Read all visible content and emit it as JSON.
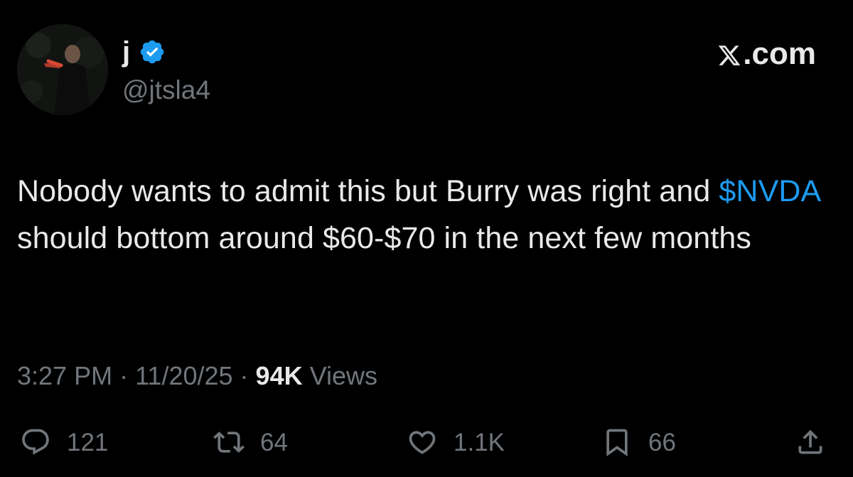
{
  "header": {
    "display_name": "j",
    "handle": "@jtsla4",
    "brand": ".com",
    "verified": true
  },
  "tweet": {
    "text_before": "Nobody wants to admit this but Burry was right and ",
    "cashtag": "$NVDA",
    "text_after": " should bottom around $60-$70 in the next few months"
  },
  "meta": {
    "time": "3:27 PM",
    "sep1": " · ",
    "date": "11/20/25",
    "sep2": " · ",
    "views_count": "94K",
    "views_label": " Views"
  },
  "actions": {
    "replies": "121",
    "reposts": "64",
    "likes": "1.1K",
    "bookmarks": "66"
  },
  "icons": {
    "verified": "verified-badge-icon",
    "x_logo": "x-logo-icon",
    "reply": "reply-icon",
    "repost": "repost-icon",
    "like": "heart-icon",
    "bookmark": "bookmark-icon",
    "share": "share-icon"
  },
  "colors": {
    "background": "#000000",
    "text": "#e7e9ea",
    "secondary": "#71767b",
    "accent": "#1d9bf0"
  }
}
